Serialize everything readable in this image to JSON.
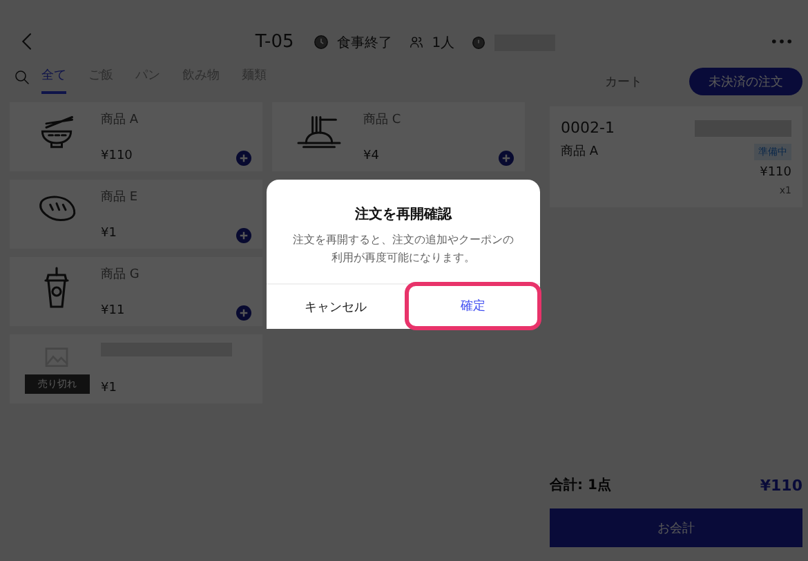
{
  "header": {
    "title": "T-05",
    "status": "食事終了",
    "guests": "1人"
  },
  "tabs": [
    {
      "label": "全て",
      "selected": true
    },
    {
      "label": "ご飯",
      "selected": false
    },
    {
      "label": "パン",
      "selected": false
    },
    {
      "label": "飲み物",
      "selected": false
    },
    {
      "label": "麺類",
      "selected": false
    }
  ],
  "right_tabs": [
    {
      "label": "カート",
      "selected": false
    },
    {
      "label": "未決済の注文",
      "selected": true
    }
  ],
  "product_columns": [
    [
      {
        "kind": "noodles",
        "name": "商品 A",
        "price": "¥110"
      },
      {
        "kind": "bread",
        "name": "商品 E",
        "price": "¥1"
      },
      {
        "kind": "drink",
        "name": "商品 G",
        "price": "¥11"
      },
      {
        "kind": "sold_out",
        "badge": "売り切れ",
        "price": "¥1"
      }
    ],
    [
      {
        "kind": "pasta",
        "name": "商品 C",
        "price": "¥4"
      }
    ]
  ],
  "order": {
    "number": "0002-1",
    "items": [
      {
        "name": "商品 A",
        "status": "準備中",
        "price": "¥110",
        "qty": "x1"
      }
    ]
  },
  "total": {
    "label": "合計: 1点",
    "amount": "¥110",
    "checkout": "お会計"
  },
  "dialog": {
    "title": "注文を再開確認",
    "message": "注文を再開すると、注文の追加やクーポンの利用が再度可能になります。",
    "buttons": [
      {
        "label": "キャンセル",
        "highlighted": false,
        "primary": false
      },
      {
        "label": "確定",
        "highlighted": true,
        "primary": true
      }
    ]
  }
}
